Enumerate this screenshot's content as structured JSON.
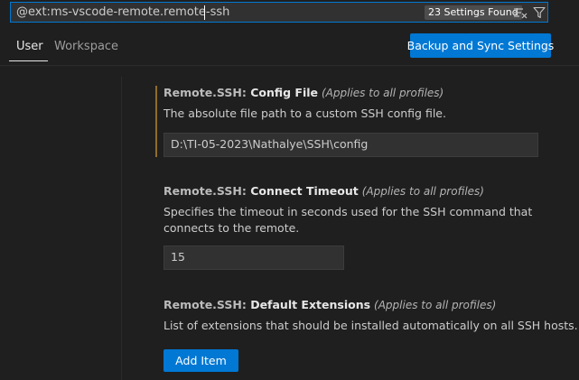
{
  "search": {
    "value": "@ext:ms-vscode-remote.remote-ssh",
    "results_badge": "23 Settings Found",
    "clear_icon": "clear-filter-icon",
    "filter_icon": "filter-icon"
  },
  "tabs": [
    {
      "label": "User",
      "active": true
    },
    {
      "label": "Workspace",
      "active": false
    }
  ],
  "backup_button": "Backup and Sync Settings",
  "settings": [
    {
      "category": "Remote.SSH: ",
      "name": "Config File",
      "scope": "(Applies to all profiles)",
      "description": "The absolute file path to a custom SSH config file.",
      "value": "D:\\TI-05-2023\\Nathalye\\SSH\\config",
      "modified": true
    },
    {
      "category": "Remote.SSH: ",
      "name": "Connect Timeout",
      "scope": "(Applies to all profiles)",
      "description": "Specifies the timeout in seconds used for the SSH command that connects to the remote.",
      "value": "15"
    },
    {
      "category": "Remote.SSH: ",
      "name": "Default Extensions",
      "scope": "(Applies to all profiles)",
      "description": "List of extensions that should be installed automatically on all SSH hosts.",
      "button": "Add Item"
    }
  ],
  "colors": {
    "accent": "#0078d4",
    "background": "#1f1f1f",
    "modified_indicator": "#8f6d2e"
  }
}
